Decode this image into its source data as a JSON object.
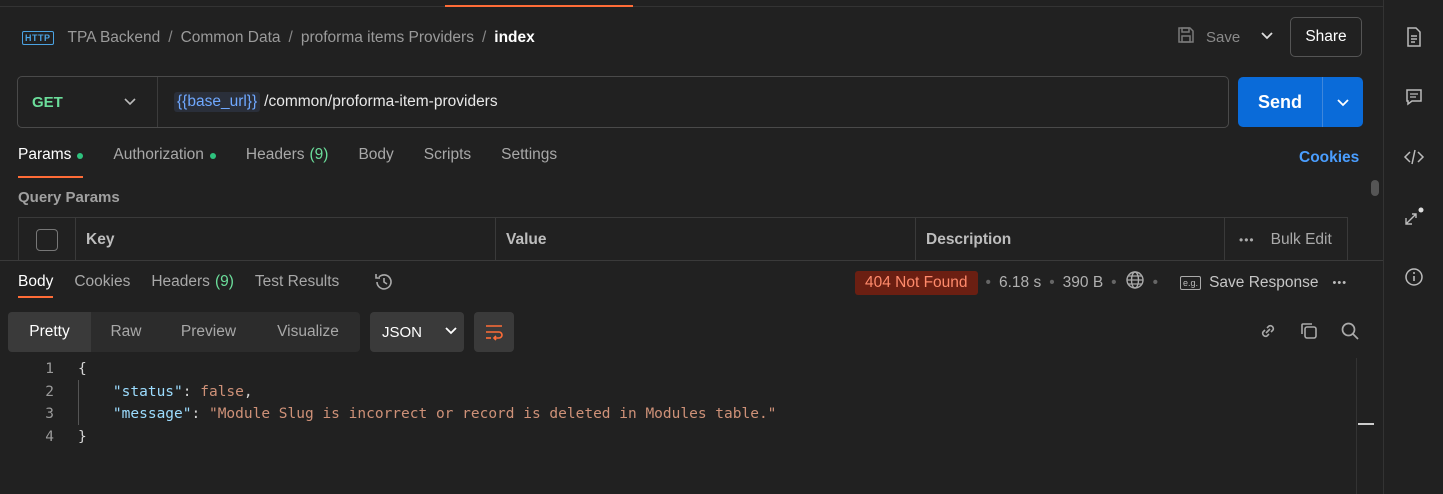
{
  "breadcrumb": {
    "protocol_badge": "HTTP",
    "items": [
      "TPA Backend",
      "Common Data",
      "proforma items Providers"
    ],
    "current": "index"
  },
  "toolbar": {
    "save_label": "Save",
    "share_label": "Share"
  },
  "request": {
    "method": "GET",
    "url_variable": "{{base_url}}",
    "url_path": "/common/proforma-item-providers",
    "send_label": "Send"
  },
  "request_tabs": [
    {
      "label": "Params",
      "dot": true,
      "active": true
    },
    {
      "label": "Authorization",
      "dot": true
    },
    {
      "label": "Headers",
      "count": "(9)"
    },
    {
      "label": "Body"
    },
    {
      "label": "Scripts"
    },
    {
      "label": "Settings"
    }
  ],
  "cookies_label": "Cookies",
  "query_params": {
    "title": "Query Params",
    "columns": [
      "Key",
      "Value",
      "Description"
    ],
    "bulk_edit_label": "Bulk Edit"
  },
  "response_tabs": [
    {
      "label": "Body",
      "active": true
    },
    {
      "label": "Cookies"
    },
    {
      "label": "Headers",
      "count": "(9)"
    },
    {
      "label": "Test Results"
    }
  ],
  "response_meta": {
    "status": "404 Not Found",
    "time": "6.18 s",
    "size": "390 B",
    "save_response_label": "Save Response",
    "save_icon_text": "e.g."
  },
  "format_tabs": [
    "Pretty",
    "Raw",
    "Preview",
    "Visualize"
  ],
  "format_select": "JSON",
  "code_lines": [
    {
      "n": "1",
      "text": "{"
    },
    {
      "n": "2",
      "key": "\"status\"",
      "value": "false",
      "comma": ","
    },
    {
      "n": "3",
      "key": "\"message\"",
      "value": "\"Module Slug is incorrect or record is deleted in Modules table.\""
    },
    {
      "n": "4",
      "text": "}"
    }
  ],
  "colors": {
    "accent": "#ff6c37",
    "send": "#0a6bd9",
    "method": "#6bdd9a",
    "status_bg": "#6b1f12",
    "status_text": "#ff8a6b"
  },
  "icons": [
    "document-icon",
    "comment-icon",
    "code-icon",
    "related-requests-icon",
    "info-icon"
  ]
}
